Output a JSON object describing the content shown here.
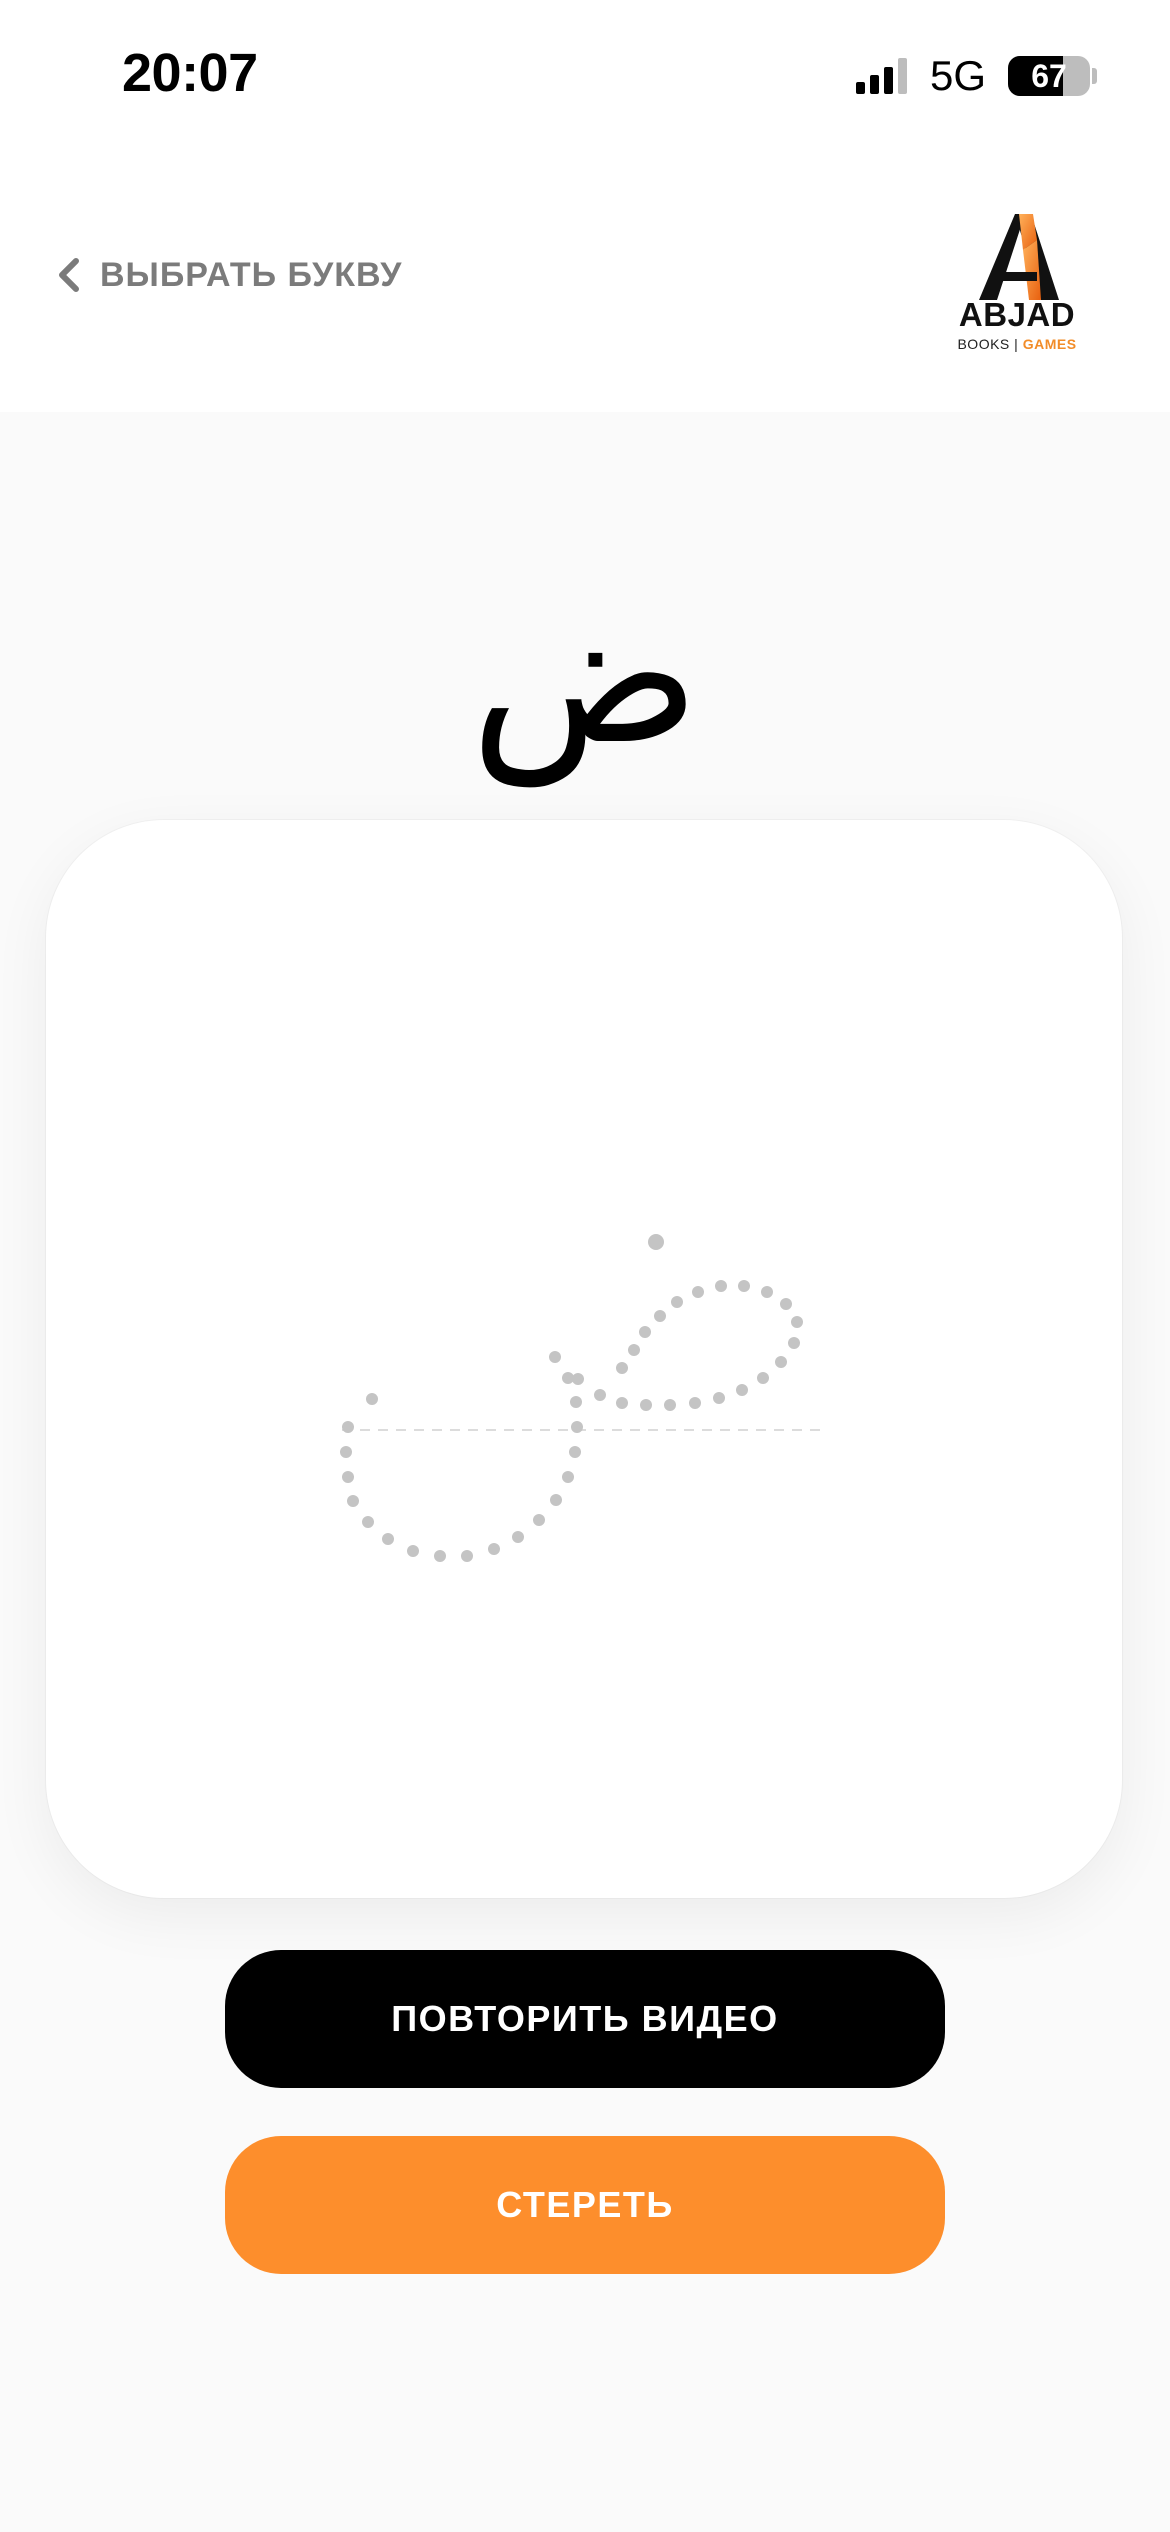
{
  "status_bar": {
    "time": "20:07",
    "network": "5G",
    "battery": "67",
    "battery_level_percent": 67
  },
  "header": {
    "back_label": "ВЫБРАТЬ БУКВУ",
    "back_icon": "chevron-left-icon",
    "logo": {
      "word": "ABJAD",
      "sub_left": "BOOKS",
      "sub_sep": " | ",
      "sub_right": "GAMES"
    }
  },
  "letter": {
    "glyph": "ض"
  },
  "actions": {
    "replay_label": "ПОВТОРИТЬ ВИДЕО",
    "erase_label": "СТЕРЕТЬ"
  },
  "colors": {
    "accent_orange": "#fd8e2c",
    "primary_black": "#000000",
    "muted_gray": "#7b7b7b",
    "trace_dot": "#c4c4c4",
    "background": "#fafafa"
  }
}
